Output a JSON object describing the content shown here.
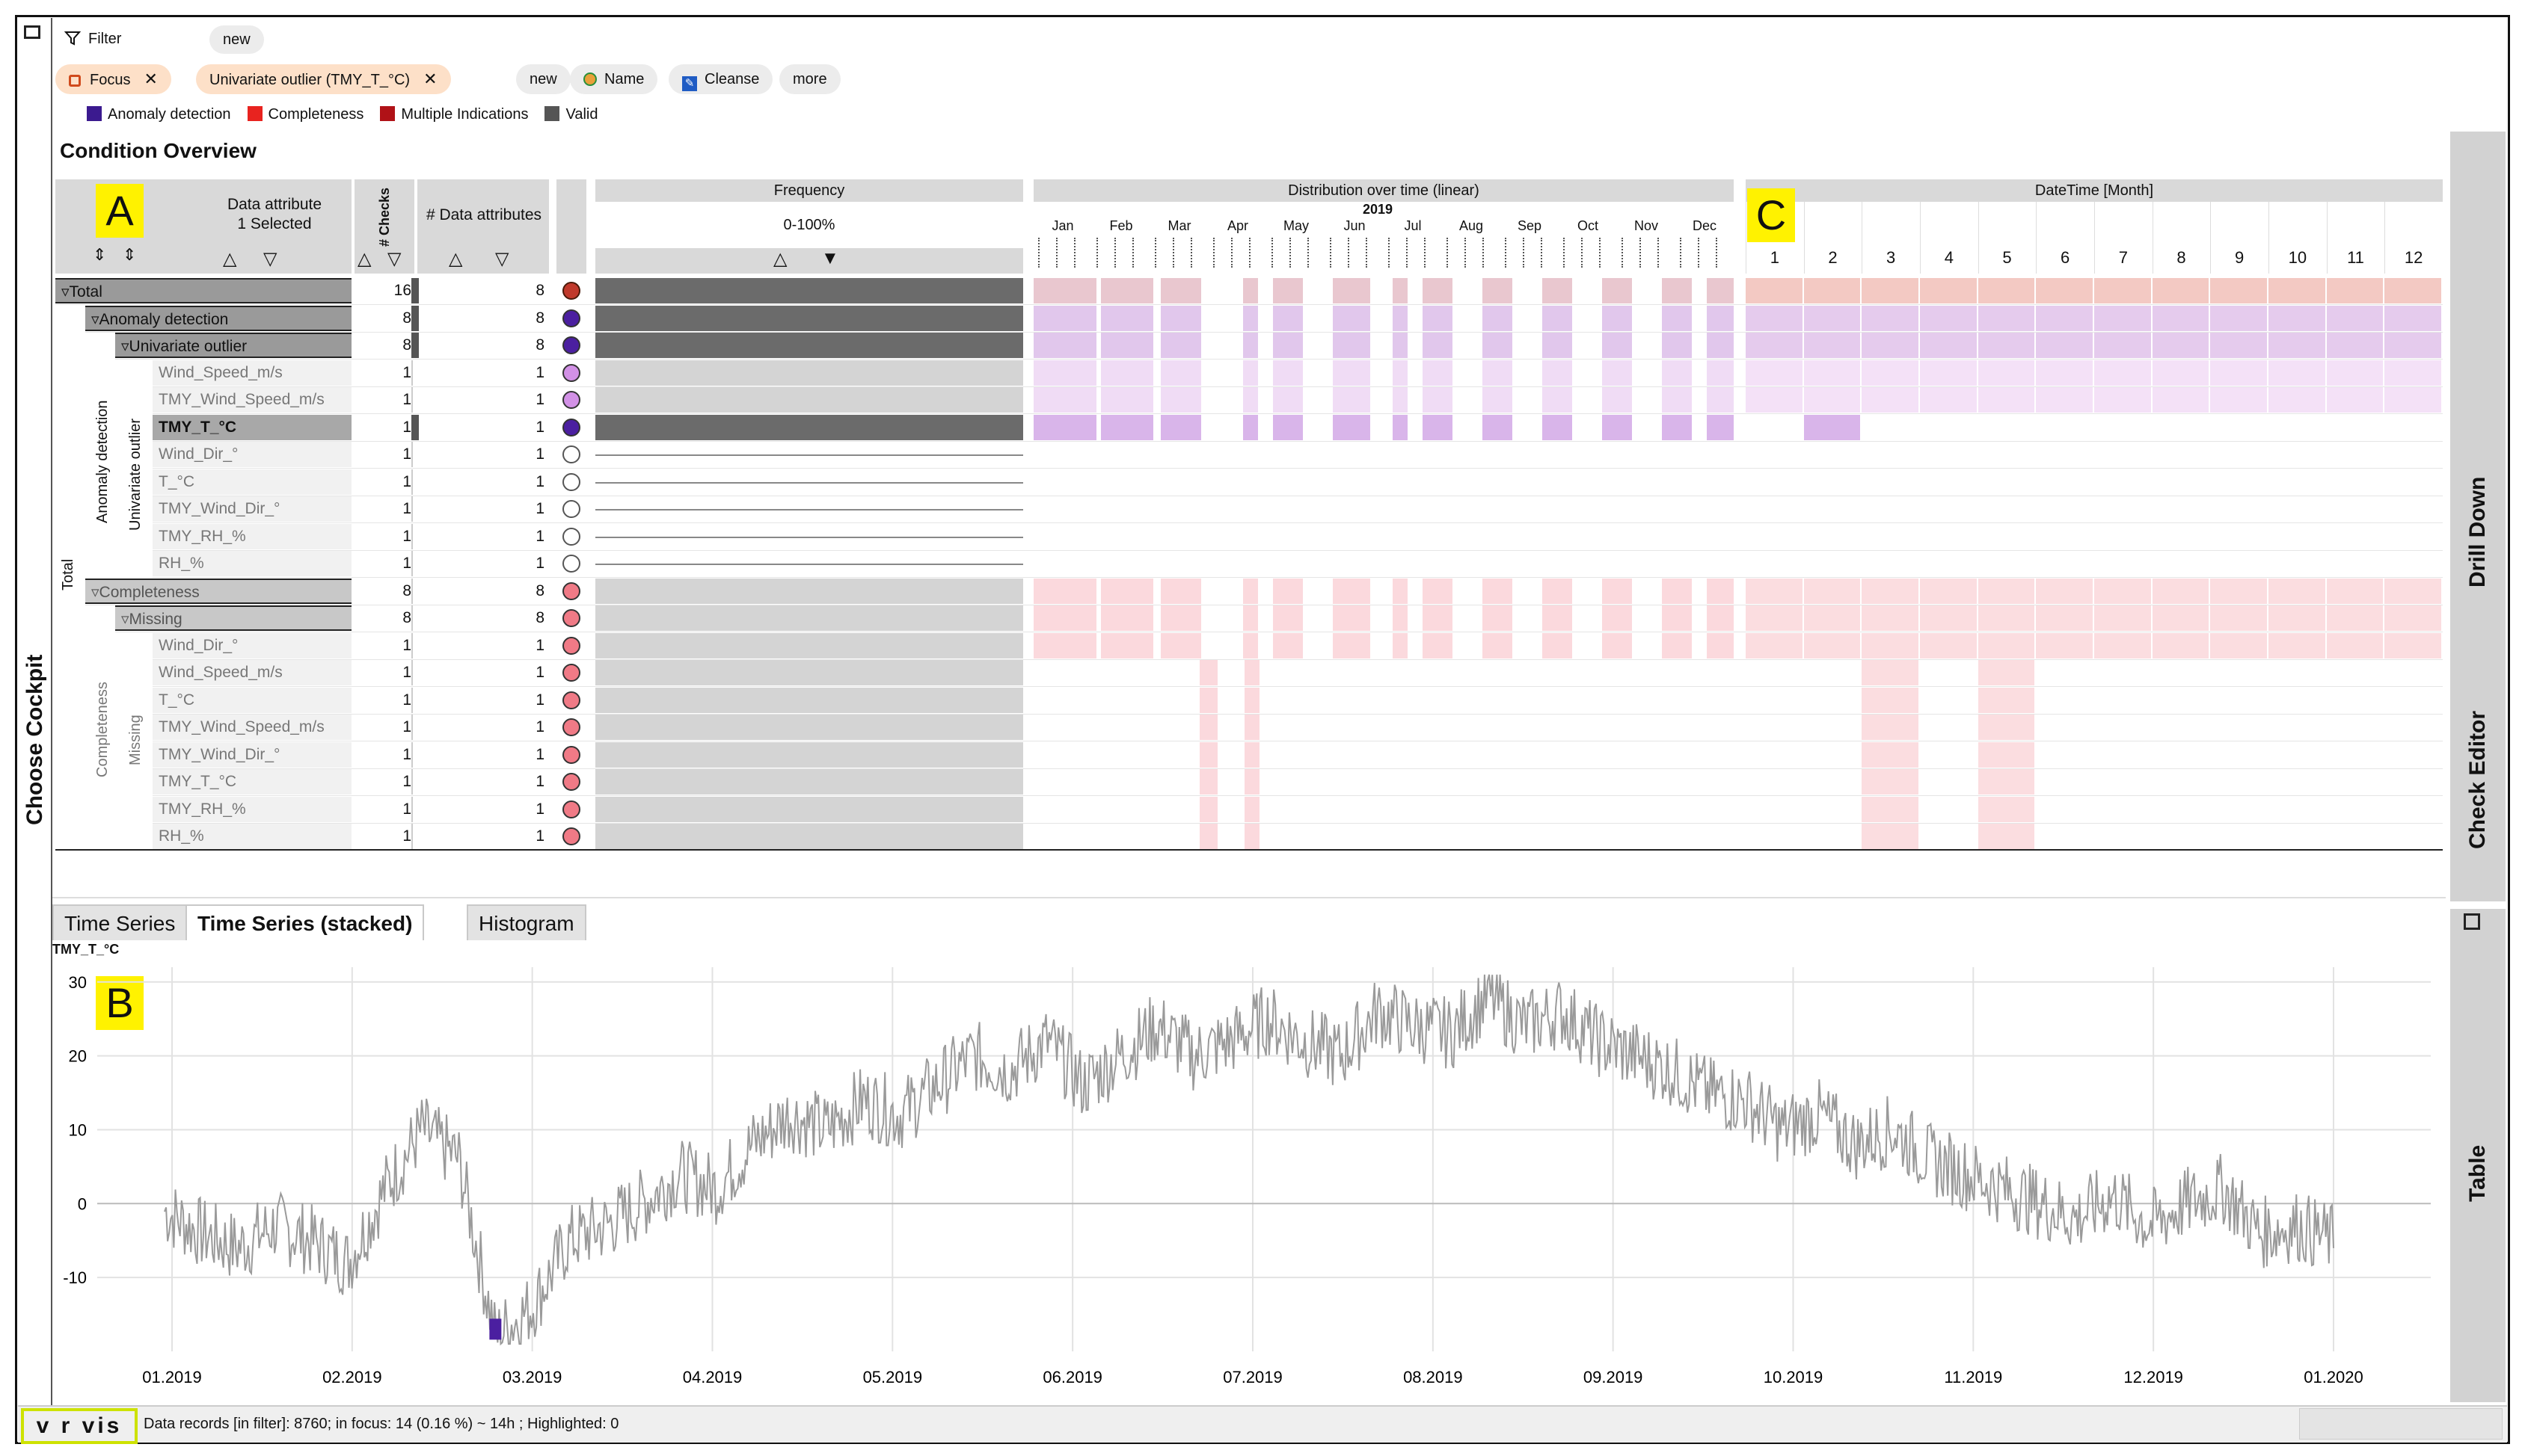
{
  "left_tab": {
    "label": "Choose Cockpit"
  },
  "right_tabs": {
    "drill_down": "Drill Down",
    "check_editor": "Check Editor",
    "table": "Table"
  },
  "filter_bar": {
    "filter_label": "Filter",
    "new_label": "new",
    "focus_chip": "Focus",
    "outlier_chip": "Univariate outlier (TMY_T_°C)",
    "new2_label": "new",
    "name_label": "Name",
    "cleanse_label": "Cleanse",
    "more_label": "more"
  },
  "legend": [
    {
      "label": "Anomaly detection",
      "color": "#3b1a8f"
    },
    {
      "label": "Completeness",
      "color": "#e8231f"
    },
    {
      "label": "Multiple Indications",
      "color": "#b01217"
    },
    {
      "label": "Valid",
      "color": "#555555"
    }
  ],
  "overview": {
    "title": "Condition Overview",
    "col_attribute_line1": "Data attribute",
    "col_attribute_line2": "1 Selected",
    "col_checks": "# Checks",
    "col_data_attrs": "# Data attributes",
    "col_frequency": "Frequency",
    "frequency_range": "0-100%",
    "col_distribution": "Distribution over time (linear)",
    "distribution_year": "2019",
    "col_datetime": "DateTime [Month]",
    "months": [
      "Jan",
      "Feb",
      "Mar",
      "Apr",
      "May",
      "Jun",
      "Jul",
      "Aug",
      "Sep",
      "Oct",
      "Nov",
      "Dec"
    ],
    "month_numbers": [
      "1",
      "2",
      "3",
      "4",
      "5",
      "6",
      "7",
      "8",
      "9",
      "10",
      "11",
      "12"
    ],
    "group_labels": {
      "total": "Total",
      "anomaly": "Anomaly detection",
      "univariate": "Univariate outlier",
      "completeness": "Completeness",
      "missing": "Missing"
    },
    "rows": [
      {
        "label": "Total",
        "checks": "16",
        "attrs": "8"
      },
      {
        "label": "Anomaly detection",
        "checks": "8",
        "attrs": "8"
      },
      {
        "label": "Univariate outlier",
        "checks": "8",
        "attrs": "8"
      },
      {
        "label": "Wind_Speed_m/s",
        "checks": "1",
        "attrs": "1"
      },
      {
        "label": "TMY_Wind_Speed_m/s",
        "checks": "1",
        "attrs": "1"
      },
      {
        "label": "TMY_T_°C",
        "checks": "1",
        "attrs": "1"
      },
      {
        "label": "Wind_Dir_°",
        "checks": "1",
        "attrs": "1"
      },
      {
        "label": "T_°C",
        "checks": "1",
        "attrs": "1"
      },
      {
        "label": "TMY_Wind_Dir_°",
        "checks": "1",
        "attrs": "1"
      },
      {
        "label": "TMY_RH_%",
        "checks": "1",
        "attrs": "1"
      },
      {
        "label": "RH_%",
        "checks": "1",
        "attrs": "1"
      },
      {
        "label": "Completeness",
        "checks": "8",
        "attrs": "8"
      },
      {
        "label": "Missing",
        "checks": "8",
        "attrs": "8"
      },
      {
        "label": "Wind_Dir_°",
        "checks": "1",
        "attrs": "1"
      },
      {
        "label": "Wind_Speed_m/s",
        "checks": "1",
        "attrs": "1"
      },
      {
        "label": "T_°C",
        "checks": "1",
        "attrs": "1"
      },
      {
        "label": "TMY_Wind_Speed_m/s",
        "checks": "1",
        "attrs": "1"
      },
      {
        "label": "TMY_Wind_Dir_°",
        "checks": "1",
        "attrs": "1"
      },
      {
        "label": "TMY_T_°C",
        "checks": "1",
        "attrs": "1"
      },
      {
        "label": "TMY_RH_%",
        "checks": "1",
        "attrs": "1"
      },
      {
        "label": "RH_%",
        "checks": "1",
        "attrs": "1"
      }
    ]
  },
  "markers": {
    "a": "A",
    "b": "B",
    "c": "C"
  },
  "bottom_tabs": [
    "Time Series",
    "Time Series (stacked)",
    "Histogram"
  ],
  "chart_data": {
    "type": "line",
    "title": "TMY_T_°C",
    "ylim": [
      -20,
      32
    ],
    "yticks": [
      "30",
      "20",
      "10",
      "0",
      "-10"
    ],
    "xticks": [
      "01.2019",
      "02.2019",
      "03.2019",
      "04.2019",
      "05.2019",
      "06.2019",
      "07.2019",
      "08.2019",
      "09.2019",
      "10.2019",
      "11.2019",
      "12.2019",
      "01.2020"
    ],
    "series": [
      {
        "values": [
          -1,
          -4,
          -6,
          -3,
          -5,
          -8,
          2,
          10,
          6,
          -18,
          -14,
          -5,
          -3,
          0,
          4,
          2,
          8,
          12,
          10,
          14,
          12,
          16,
          20,
          18,
          22,
          16,
          20,
          24,
          20,
          22,
          25,
          22,
          20,
          26,
          24,
          23,
          28,
          24,
          26,
          22,
          20,
          18,
          15,
          14,
          10,
          12,
          8,
          10,
          6,
          4,
          2,
          0,
          -2,
          1,
          -3,
          0,
          2,
          -4,
          -3,
          -5
        ]
      }
    ],
    "outlier_points": [
      {
        "x": 9,
        "y": -17
      }
    ]
  },
  "status": {
    "logo": "v r vis",
    "text": "Data records [in filter]: 8760; in focus: 14 (0.16 %) ~ 14h ; Highlighted: 0"
  }
}
